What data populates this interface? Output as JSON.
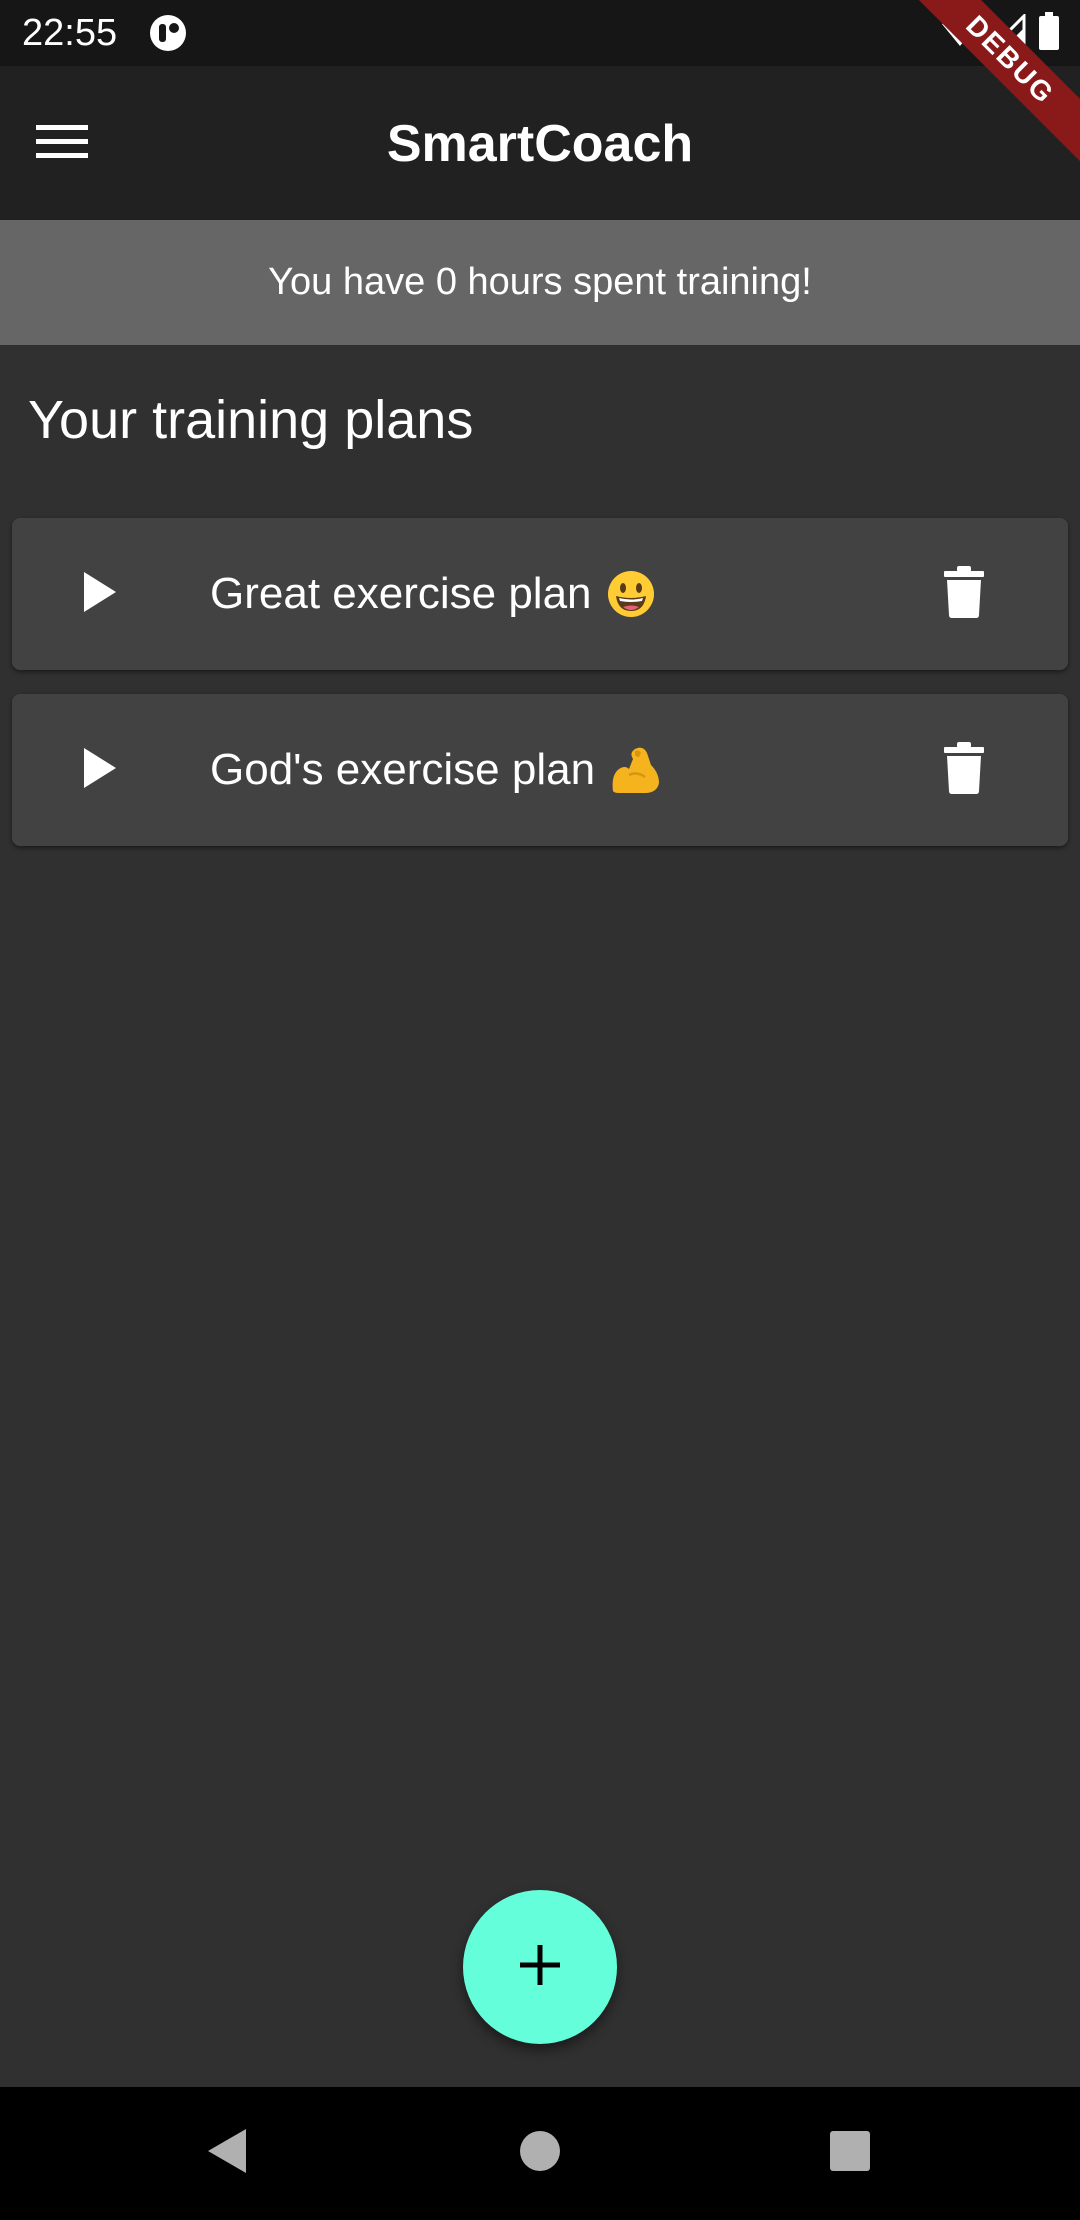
{
  "status_bar": {
    "time": "22:55",
    "icons": [
      "app-notification-icon",
      "wifi-icon",
      "signal-icon",
      "battery-icon"
    ]
  },
  "debug_banner": "DEBUG",
  "app_bar": {
    "title": "SmartCoach",
    "menu_icon": "menu-icon"
  },
  "summary": {
    "text": "You have 0 hours spent training!"
  },
  "section_title": "Your training plans",
  "plans": [
    {
      "title": "Great exercise plan",
      "emoji_icon": "grinning-face-emoji"
    },
    {
      "title": "God's exercise plan",
      "emoji_icon": "flexed-biceps-emoji"
    }
  ],
  "fab": {
    "icon": "plus-icon"
  },
  "nav_bar": {
    "icons": [
      "back-icon",
      "home-icon",
      "recents-icon"
    ]
  },
  "colors": {
    "background": "#303030",
    "app_bar": "#212121",
    "summary_banner": "#666666",
    "card": "#424242",
    "accent": "#64ffda",
    "debug_banner": "#8a1a1a"
  }
}
